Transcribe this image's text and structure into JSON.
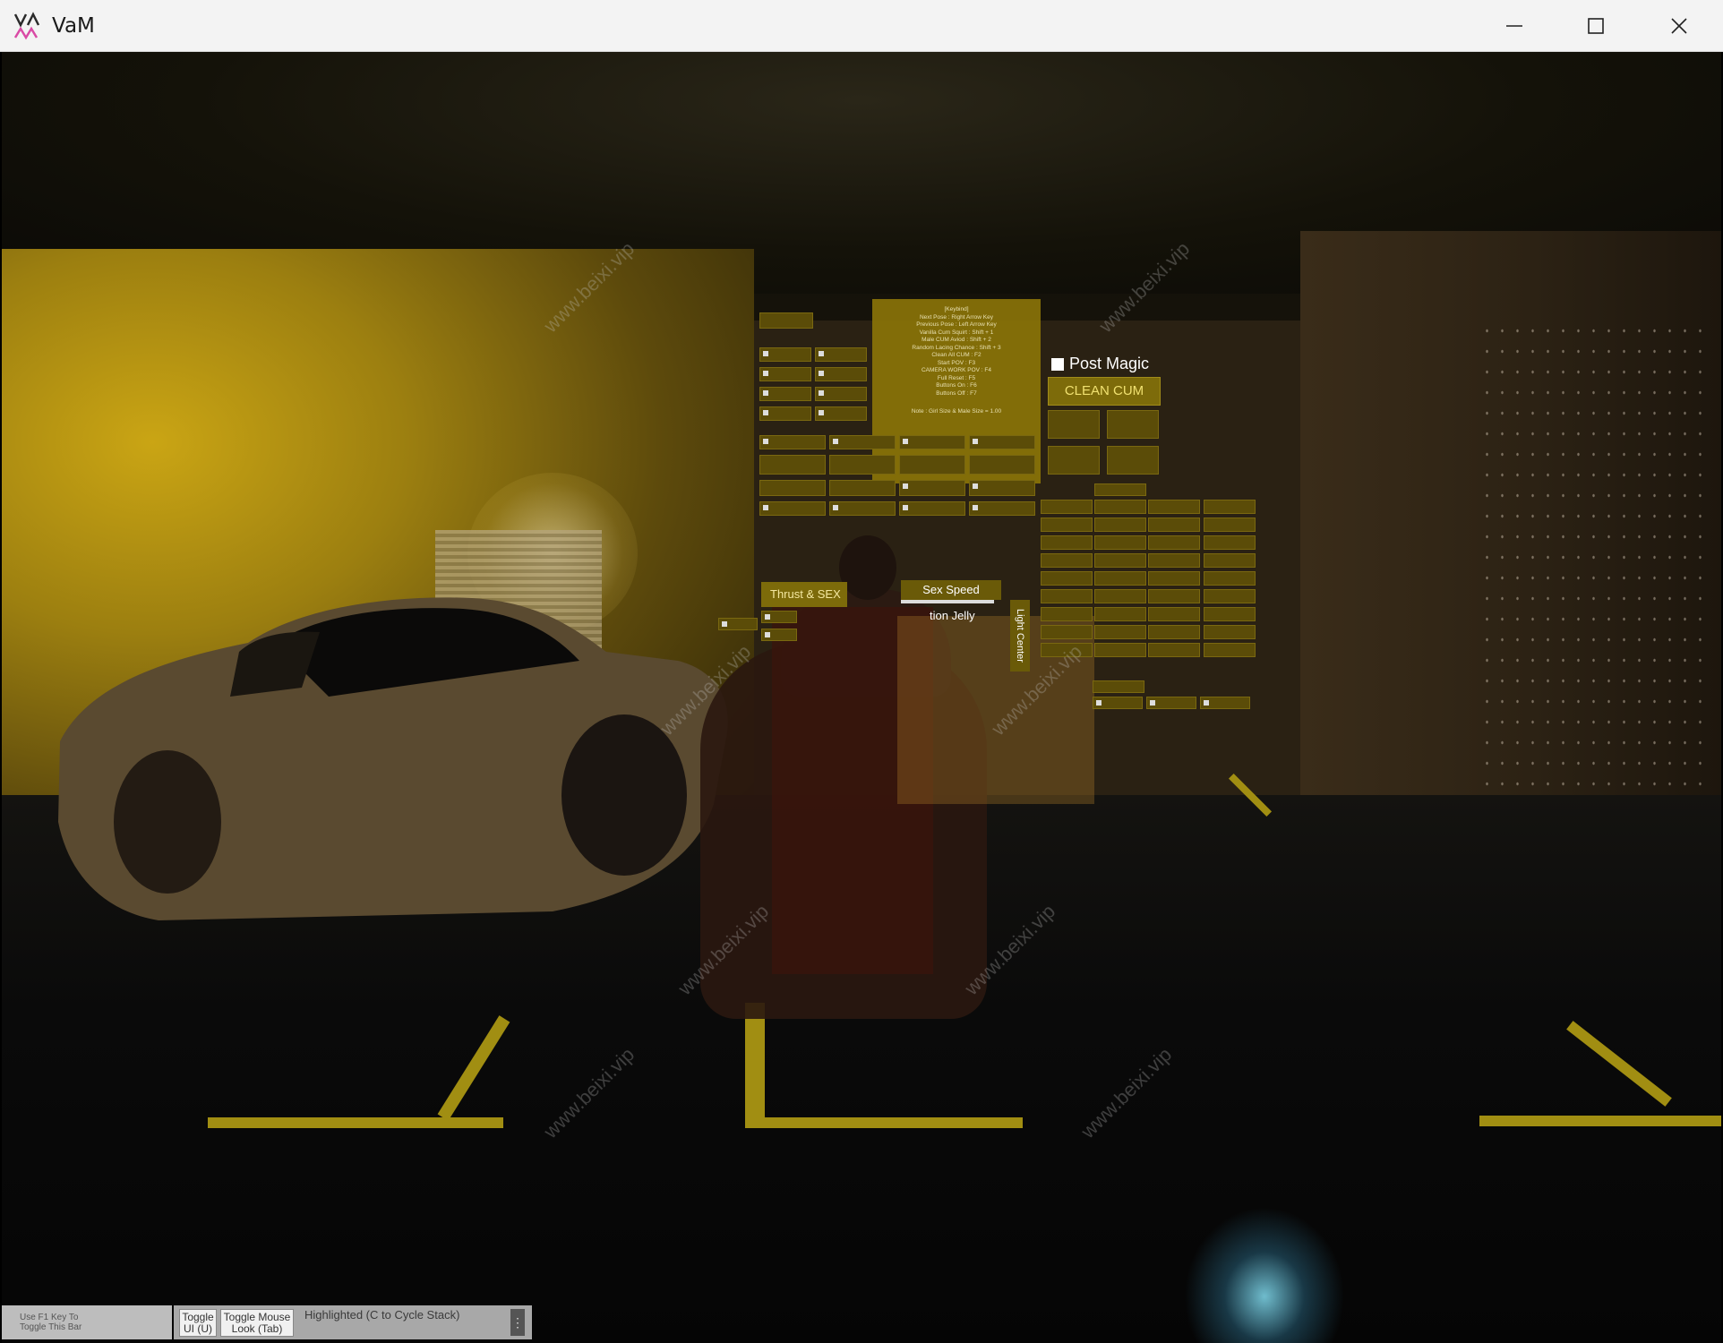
{
  "window": {
    "title": "VaM"
  },
  "scene": {
    "post_magic_label": "Post Magic",
    "clean_cum_label": "CLEAN CUM",
    "thrust_label": "Thrust & SEX",
    "sex_speed_label": "Sex Speed",
    "jelly_label": "tion Jelly",
    "light_center_label": "Light Center",
    "info_board": {
      "heading": "[Keybind]",
      "lines": [
        "Next Pose : Right Arrow Key",
        "Previous Pose : Left Arrow Key",
        "Vanilla Cum Squirt : Shift + 1",
        "Male CUM Aviod : Shift + 2",
        "Random Lacing Chance : Shift + 3",
        "Clean All CUM : F2",
        "Start POV : F3",
        "CAMERA WORK POV : F4",
        "Full Reset : F5",
        "Buttons On : F6",
        "Buttons Off : F7",
        "Note : Girl Size & Male Size = 1.00"
      ]
    },
    "watermark_text": "www.beixi.vip"
  },
  "bottom_bar": {
    "f1_hint_line1": "Use F1 Key To",
    "f1_hint_line2": "Toggle This Bar",
    "toggle_ui_line1": "Toggle",
    "toggle_ui_line2": "UI (U)",
    "toggle_mouse_line1": "Toggle Mouse",
    "toggle_mouse_line2": "Look (Tab)",
    "highlighted_label": "Highlighted (C to Cycle Stack)",
    "menu_icon": "⋮"
  }
}
